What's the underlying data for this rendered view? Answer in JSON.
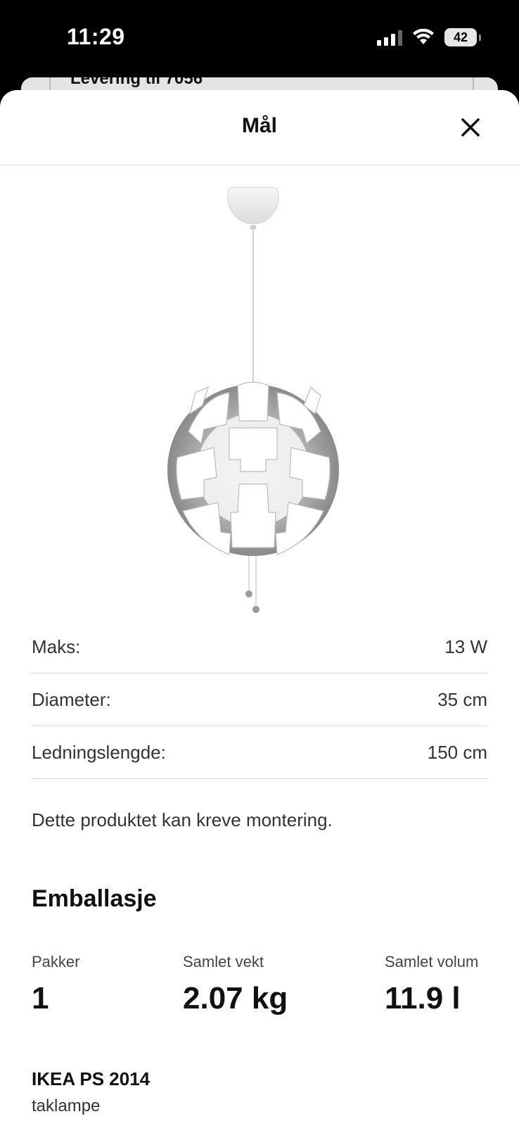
{
  "status_bar": {
    "time": "11:29",
    "battery": "42"
  },
  "behind_sheet": {
    "text": "Levering til 7056"
  },
  "sheet": {
    "title": "Mål"
  },
  "specs": [
    {
      "label": "Maks:",
      "value": "13 W"
    },
    {
      "label": "Diameter:",
      "value": "35 cm"
    },
    {
      "label": "Ledningslengde:",
      "value": "150 cm"
    }
  ],
  "note": "Dette produktet kan kreve montering.",
  "packaging": {
    "title": "Emballasje",
    "items": [
      {
        "label": "Pakker",
        "value": "1"
      },
      {
        "label": "Samlet vekt",
        "value": "2.07 kg"
      },
      {
        "label": "Samlet volum",
        "value": "11.9 l"
      }
    ]
  },
  "product": {
    "name": "IKEA PS 2014",
    "type": "taklampe"
  }
}
